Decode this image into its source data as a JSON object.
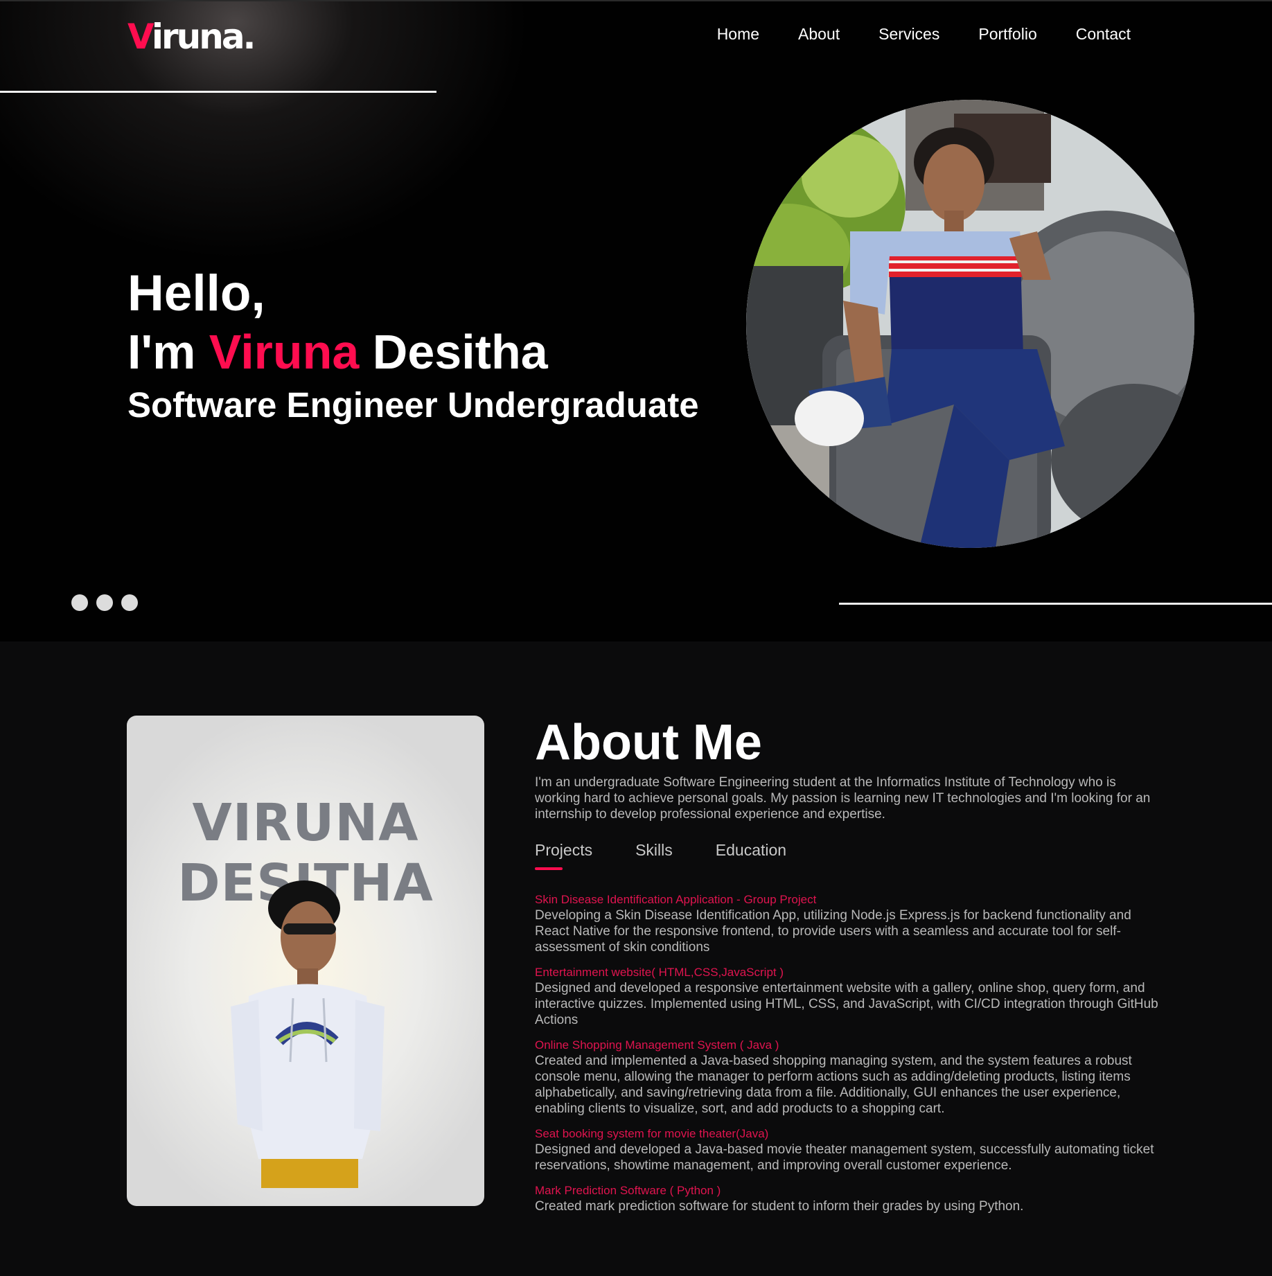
{
  "brand": {
    "logo_first": "V",
    "logo_rest": "iruna.",
    "accent_color": "#ff0d4f"
  },
  "nav": {
    "items": [
      {
        "label": "Home"
      },
      {
        "label": "About"
      },
      {
        "label": "Services"
      },
      {
        "label": "Portfolio"
      },
      {
        "label": "Contact"
      }
    ]
  },
  "hero": {
    "greeting": "Hello,",
    "intro_prefix": "I'm ",
    "first_name": "Viruna",
    "last_name": " Desitha",
    "subtitle": "Software Engineer Undergraduate",
    "slider_dots": 3
  },
  "about": {
    "title": "About Me",
    "poster_line1": "VIRUNA",
    "poster_line2": "DESITHA",
    "description": "I'm an undergraduate Software Engineering student at the Informatics Institute of Technology who is working hard to achieve personal goals. My passion is learning new IT technologies and I'm looking for an internship to develop professional experience and expertise.",
    "tabs": [
      {
        "label": "Projects",
        "active": true
      },
      {
        "label": "Skills",
        "active": false
      },
      {
        "label": "Education",
        "active": false
      }
    ],
    "projects": [
      {
        "title": "Skin Disease Identification Application - Group Project",
        "desc": "Developing a Skin Disease Identification App, utilizing Node.js Express.js for backend functionality and React Native for the responsive frontend, to provide users with a seamless and accurate tool for self-assessment of skin conditions"
      },
      {
        "title": "Entertainment website( HTML,CSS,JavaScript )",
        "desc": "Designed and developed a responsive entertainment website with a gallery, online shop, query form, and interactive quizzes. Implemented using HTML, CSS, and JavaScript, with CI/CD integration through GitHub Actions"
      },
      {
        "title": "Online Shopping Management System ( Java )",
        "desc": "Created and implemented a Java-based shopping managing system, and the system features a robust console menu, allowing the manager to perform actions such as adding/deleting products, listing items alphabetically, and saving/retrieving data from a file. Additionally, GUI enhances the user experience, enabling clients to visualize, sort, and add products to a shopping cart."
      },
      {
        "title": "Seat booking system for movie theater(Java)",
        "desc": "Designed and developed a Java-based movie theater management system, successfully automating ticket reservations, showtime management, and improving overall customer experience."
      },
      {
        "title": "Mark Prediction Software ( Python )",
        "desc": "Created mark prediction software for student to inform their grades by using Python."
      }
    ]
  }
}
